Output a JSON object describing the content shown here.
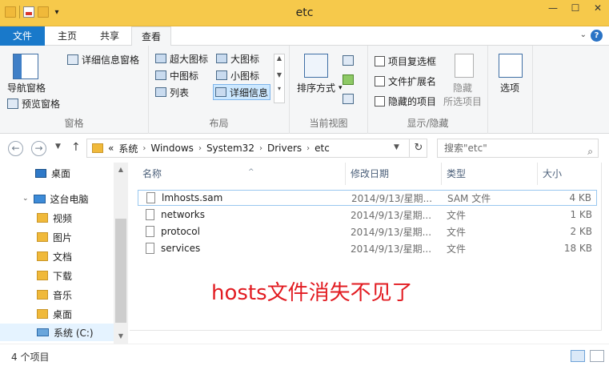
{
  "window": {
    "title": "etc"
  },
  "ribbon_tabs": [
    "文件",
    "主页",
    "共享",
    "查看"
  ],
  "ribbon": {
    "panes": {
      "nav_pane": "导航窗格",
      "preview_pane": "预览窗格",
      "details_pane": "详细信息窗格",
      "label": "窗格"
    },
    "layout": {
      "items": [
        "超大图标",
        "大图标",
        "中图标",
        "小图标",
        "列表",
        "详细信息"
      ],
      "selected": "详细信息",
      "label": "布局"
    },
    "current_view": {
      "sort": "排序方式",
      "label": "当前视图"
    },
    "show_hide": {
      "checkboxes": [
        "项目复选框",
        "文件扩展名",
        "隐藏的项目"
      ],
      "hide_selected": "隐藏",
      "hide_selected_2": "所选项目",
      "label": "显示/隐藏"
    },
    "options": "选项"
  },
  "address": {
    "crumbs": [
      "«",
      "系统",
      "Windows",
      "System32",
      "Drivers",
      "etc"
    ],
    "search_placeholder": "搜索\"etc\""
  },
  "navigation": [
    {
      "label": "桌面",
      "icon": "desktop-icon"
    },
    {
      "label": "这台电脑",
      "icon": "computer-icon"
    },
    {
      "label": "视频",
      "icon": "folder-icon"
    },
    {
      "label": "图片",
      "icon": "folder-icon"
    },
    {
      "label": "文档",
      "icon": "folder-icon"
    },
    {
      "label": "下载",
      "icon": "folder-icon"
    },
    {
      "label": "音乐",
      "icon": "folder-icon"
    },
    {
      "label": "桌面",
      "icon": "folder-icon"
    },
    {
      "label": "系统 (C:)",
      "icon": "drive-icon",
      "selected": true
    }
  ],
  "columns": {
    "name": "名称",
    "date": "修改日期",
    "type": "类型",
    "size": "大小"
  },
  "files": [
    {
      "name": "lmhosts.sam",
      "date": "2014/9/13/星期...",
      "type": "SAM 文件",
      "size": "4 KB"
    },
    {
      "name": "networks",
      "date": "2014/9/13/星期...",
      "type": "文件",
      "size": "1 KB"
    },
    {
      "name": "protocol",
      "date": "2014/9/13/星期...",
      "type": "文件",
      "size": "2 KB"
    },
    {
      "name": "services",
      "date": "2014/9/13/星期...",
      "type": "文件",
      "size": "18 KB"
    }
  ],
  "annotation": "hosts文件消失不见了",
  "status": {
    "item_count": "4 个项目"
  },
  "colors": {
    "file_tab": "#1979ca",
    "titlebar": "#f6c94b",
    "annotation": "#e21c22"
  }
}
